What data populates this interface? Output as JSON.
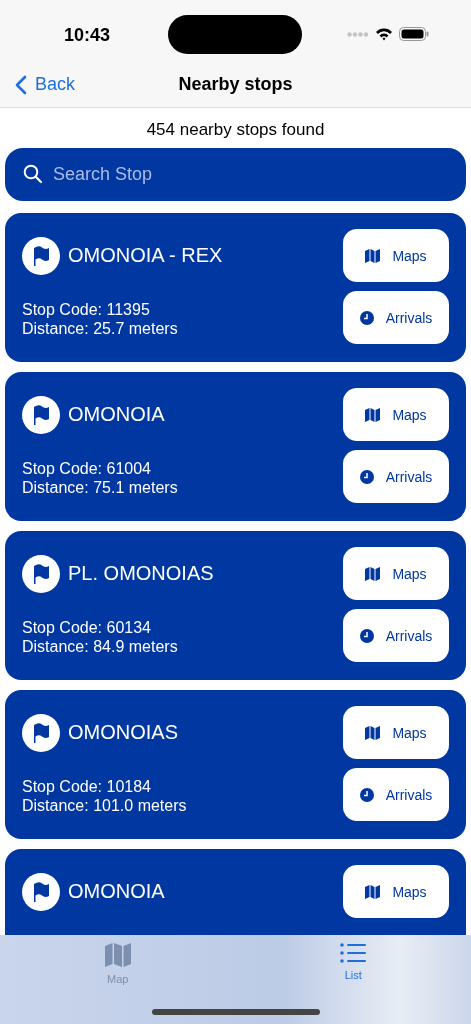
{
  "status_bar": {
    "time": "10:43"
  },
  "nav": {
    "back": "Back",
    "title": "Nearby stops"
  },
  "summary": "454 nearby stops found",
  "search": {
    "placeholder": "Search Stop"
  },
  "stops": [
    {
      "name": "OMONOIA - REX",
      "code": "Stop Code: 11395",
      "distance": "Distance: 25.7 meters",
      "maps": "Maps",
      "arrivals": "Arrivals"
    },
    {
      "name": "OMONOIA",
      "code": "Stop Code: 61004",
      "distance": "Distance: 75.1 meters",
      "maps": "Maps",
      "arrivals": "Arrivals"
    },
    {
      "name": "PL. OMONOIAS",
      "code": "Stop Code: 60134",
      "distance": "Distance: 84.9 meters",
      "maps": "Maps",
      "arrivals": "Arrivals"
    },
    {
      "name": "OMONOIAS",
      "code": "Stop Code: 10184",
      "distance": "Distance: 101.0 meters",
      "maps": "Maps",
      "arrivals": "Arrivals"
    },
    {
      "name": "OMONOIA",
      "maps": "Maps"
    }
  ],
  "tabs": [
    {
      "label": "Map",
      "kind": "map",
      "selected": false
    },
    {
      "label": "List",
      "kind": "list",
      "selected": true
    }
  ]
}
